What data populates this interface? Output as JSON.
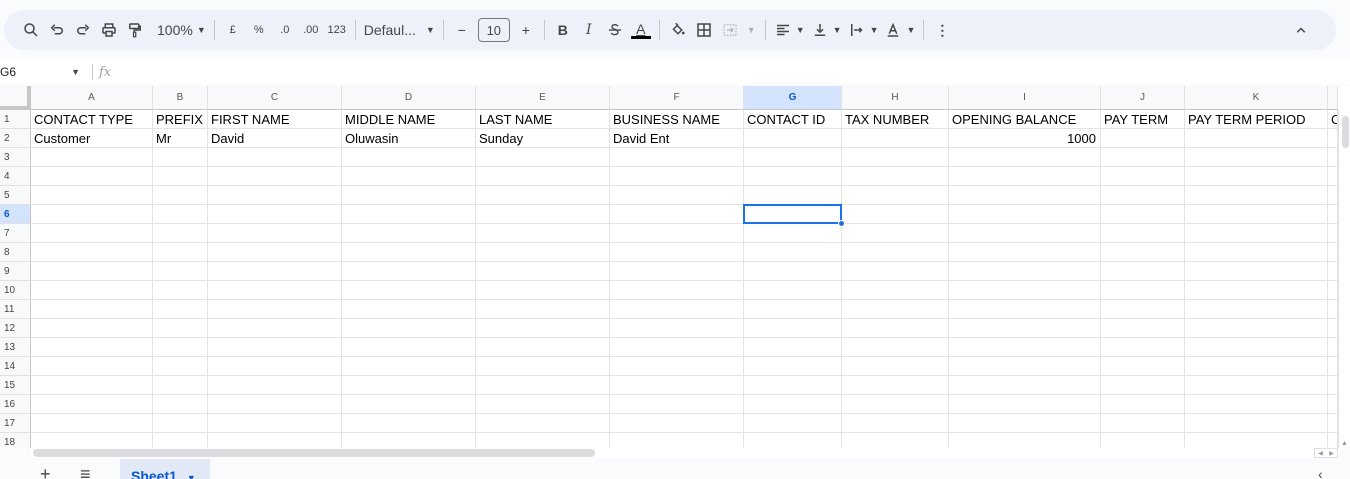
{
  "toolbar": {
    "zoom": "100%",
    "currency": "£",
    "percent": "%",
    "decrease_decimal": ".0",
    "increase_decimal": ".00",
    "number_format": "123",
    "font": "Defaul...",
    "font_size": "10",
    "bold": "B",
    "italic": "I",
    "text_color": "A",
    "more": "⋮",
    "icons": [
      "search-icon",
      "undo-icon",
      "redo-icon",
      "print-icon",
      "paint-format-icon",
      "fill-color-icon",
      "borders-icon",
      "merge-icon",
      "align-icon",
      "valign-icon",
      "wrap-icon",
      "rotate-icon",
      "collapse-icon"
    ]
  },
  "formula_bar": {
    "name_box": "G6",
    "fx": "fx",
    "value": ""
  },
  "grid": {
    "columns": [
      "A",
      "B",
      "C",
      "D",
      "E",
      "F",
      "G",
      "H",
      "I",
      "J",
      "K"
    ],
    "selected_column": "G",
    "rows": [
      "1",
      "2",
      "3",
      "4",
      "5",
      "6",
      "7",
      "8",
      "9",
      "10",
      "11",
      "12",
      "13",
      "14",
      "15",
      "16",
      "17",
      "18"
    ],
    "selected_row": "6",
    "header_row": [
      "CONTACT TYPE",
      "PREFIX",
      "FIRST NAME",
      "MIDDLE NAME",
      "LAST NAME",
      "BUSINESS NAME",
      "CONTACT ID",
      "TAX NUMBER",
      "OPENING BALANCE",
      "PAY TERM",
      "PAY TERM PERIOD"
    ],
    "overflow_text": "C",
    "data_row": [
      "Customer",
      "Mr",
      "David",
      "Oluwasin",
      "Sunday",
      "David Ent",
      "",
      "",
      "1000",
      "",
      ""
    ]
  },
  "sheets": {
    "tabs": [
      "Sheet1"
    ]
  }
}
